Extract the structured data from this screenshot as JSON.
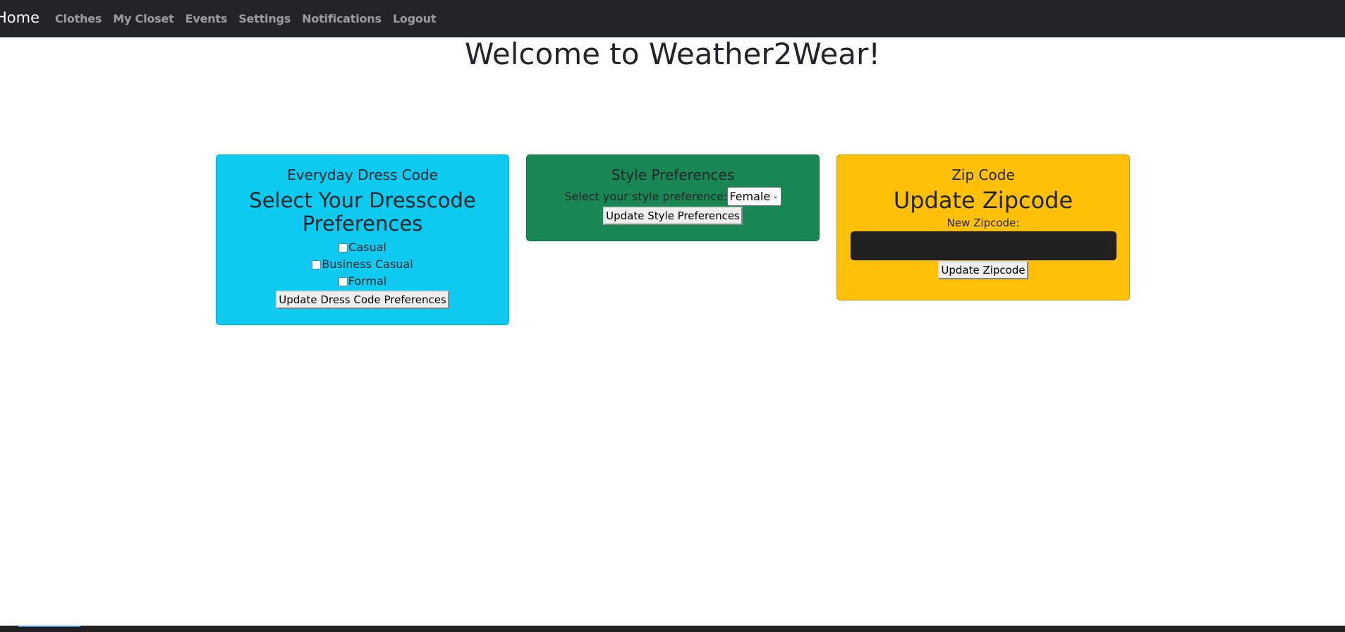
{
  "nav": {
    "brand": "Home",
    "links": [
      "Clothes",
      "My Closet",
      "Events",
      "Settings",
      "Notifications",
      "Logout"
    ]
  },
  "page": {
    "title": "Welcome to Weather2Wear!"
  },
  "dress_card": {
    "title": "Everyday Dress Code",
    "heading_line1": "Select Your Dresscode",
    "heading_line2": "Preferences",
    "options": [
      {
        "label": "Casual",
        "checked": false
      },
      {
        "label": "Business Casual",
        "checked": false
      },
      {
        "label": "Formal",
        "checked": false
      }
    ],
    "button": "Update Dress Code Preferences",
    "color": "#0dcaf0"
  },
  "style_card": {
    "title": "Style Preferences",
    "select_label": "Select your style preference:",
    "selected": "Female",
    "button": "Update Style Preferences",
    "color": "#198754"
  },
  "zip_card": {
    "title": "Zip Code",
    "heading": "Update Zipcode",
    "input_label": "New Zipcode:",
    "input_value": "",
    "button": "Update Zipcode",
    "color": "#ffc107"
  }
}
